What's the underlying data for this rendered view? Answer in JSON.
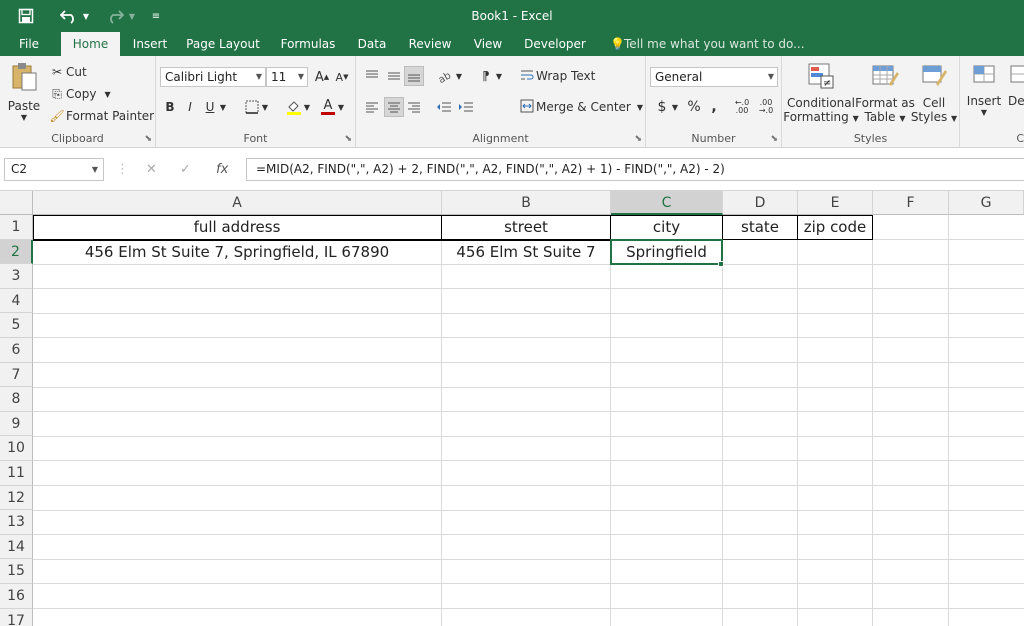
{
  "window": {
    "title": "Book1 - Excel"
  },
  "quick_access": {
    "save_icon": "save-icon",
    "undo_icon": "undo-icon",
    "redo_icon": "redo-icon",
    "customize_icon": "customize-icon"
  },
  "tabs": [
    {
      "label": "File"
    },
    {
      "label": "Home"
    },
    {
      "label": "Insert"
    },
    {
      "label": "Page Layout"
    },
    {
      "label": "Formulas"
    },
    {
      "label": "Data"
    },
    {
      "label": "Review"
    },
    {
      "label": "View"
    },
    {
      "label": "Developer"
    }
  ],
  "tell_me": "Tell me what you want to do...",
  "ribbon": {
    "clipboard": {
      "label": "Clipboard",
      "paste": "Paste",
      "cut": "Cut",
      "copy": "Copy",
      "format_painter": "Format Painter"
    },
    "font": {
      "label": "Font",
      "font_name": "Calibri Light",
      "font_size": "11",
      "bold": "B",
      "italic": "I",
      "underline": "U"
    },
    "alignment": {
      "label": "Alignment",
      "wrap_text": "Wrap Text",
      "merge_center": "Merge & Center"
    },
    "number": {
      "label": "Number",
      "format": "General",
      "currency": "$",
      "percent": "%",
      "comma": ","
    },
    "styles": {
      "label": "Styles",
      "conditional_1": "Conditional",
      "conditional_2": "Formatting",
      "format_table_1": "Format as",
      "format_table_2": "Table",
      "cell_styles_1": "Cell",
      "cell_styles_2": "Styles"
    },
    "cells": {
      "insert": "Insert",
      "delete_partial": "De",
      "label_partial": "C"
    }
  },
  "formula_bar": {
    "name_box": "C2",
    "formula": "=MID(A2, FIND(\",\", A2) + 2, FIND(\",\", A2, FIND(\",\", A2) + 1) - FIND(\",\", A2) - 2)"
  },
  "grid": {
    "columns": [
      "A",
      "B",
      "C",
      "D",
      "E",
      "F",
      "G"
    ],
    "rows": [
      "1",
      "2",
      "3",
      "4",
      "5",
      "6",
      "7",
      "8",
      "9",
      "10",
      "11",
      "12",
      "13",
      "14",
      "15",
      "16",
      "17"
    ],
    "cells": {
      "A1": "full address",
      "B1": "street",
      "C1": "city",
      "D1": "state",
      "E1": "zip code",
      "A2": "456 Elm St Suite 7, Springfield, IL 67890",
      "B2": "456 Elm St Suite 7",
      "C2": "Springfield"
    },
    "selected_cell": "C2"
  },
  "colors": {
    "accent": "#217346"
  }
}
